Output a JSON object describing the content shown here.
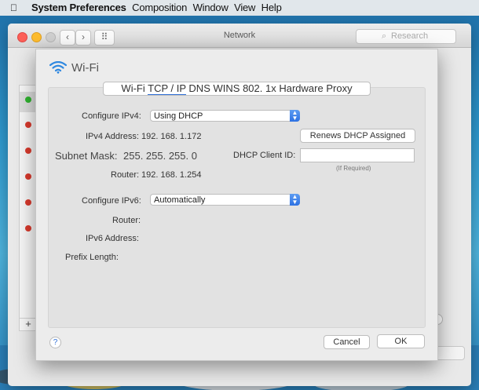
{
  "menubar": {
    "apple_icon": "apple-logo-icon",
    "app_name": "System Preferences",
    "items": [
      "Composition",
      "Window",
      "View",
      "Help"
    ]
  },
  "window": {
    "title": "Network",
    "search_placeholder": "Research",
    "back_glyph": "‹",
    "forward_glyph": "›",
    "grid_glyph": "⠿",
    "add_glyph": "+",
    "search_icon_glyph": "⌕"
  },
  "sheet": {
    "title": "Wi-Fi",
    "tabs": [
      "Wi-Fi",
      "TCP / IP",
      "DNS",
      "WINS",
      "802. 1x",
      "Hardware",
      "Proxy"
    ],
    "selected_tab": "TCP / IP",
    "ipv4": {
      "configure_label": "Configure IPv4:",
      "configure_value": "Using DHCP",
      "address_label": "IPv4 Address:",
      "address_value": "192. 168. 1.172",
      "renew_button": "Renews DHCP Assigned",
      "subnet_label": "Subnet Mask:",
      "subnet_value": "255. 255. 255. 0",
      "client_id_label": "DHCP Client ID:",
      "client_id_value": "",
      "client_id_hint": "(If Required)",
      "router_label": "Router:",
      "router_value": "192. 168. 1.254"
    },
    "ipv6": {
      "configure_label": "Configure IPv6:",
      "configure_value": "Automatically",
      "router_label": "Router:",
      "address_label": "IPv6 Address:",
      "prefix_label": "Prefix Length:"
    },
    "help_glyph": "?",
    "cancel_button": "Cancel",
    "ok_button": "OK"
  },
  "colors": {
    "accent": "#2f6fd6",
    "status_connected": "#30b530",
    "status_disconnected": "#d93a2d"
  }
}
